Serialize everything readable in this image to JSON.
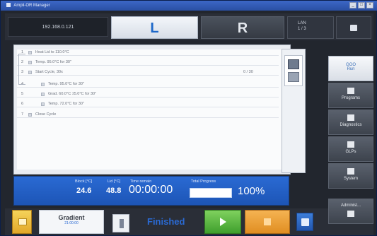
{
  "window": {
    "title": "Ampli-OR Manager"
  },
  "header": {
    "ip": "192.168.0.121",
    "tab_left": "L",
    "tab_right": "R",
    "lan_line1": "LAN",
    "lan_line2": "1 / 3"
  },
  "protocol": {
    "steps": [
      {
        "num": "1",
        "text": "Heat Lid to 110.0°C",
        "extra": ""
      },
      {
        "num": "2",
        "text": "Temp. 95.0°C for 30\"",
        "extra": ""
      },
      {
        "num": "3",
        "text": "Start Cycle, 30x",
        "extra": "0 / 30"
      },
      {
        "num": "4",
        "text": "Temp. 95.0°C for 30\"",
        "extra": ""
      },
      {
        "num": "5",
        "text": "Grad. 60.0°C ±5.0°C  for 30\"",
        "extra": ""
      },
      {
        "num": "6",
        "text": "Temp. 72.0°C for 30\"",
        "extra": ""
      },
      {
        "num": "7",
        "text": "Close Cycle",
        "extra": ""
      }
    ]
  },
  "status": {
    "block_label": "Block [°C]",
    "block_value": "24.6",
    "lid_label": "Lid [°C]",
    "lid_value": "48.8",
    "time_label": "Time remain",
    "time_value": "00:00:00",
    "progress_label": "Total Progress",
    "progress_percent": "100%",
    "progress_fraction": 1.0
  },
  "bottom": {
    "gradient_title": "Gradient",
    "gradient_sub": "21:00:00",
    "state": "Finished"
  },
  "nav": {
    "items": [
      {
        "label_line1": "GOO",
        "label_line2": "Run",
        "icon": "run-icon"
      },
      {
        "label_line1": "",
        "label_line2": "Programs",
        "icon": "programs-icon"
      },
      {
        "label_line1": "",
        "label_line2": "Diagnostics",
        "icon": "diagnostics-icon"
      },
      {
        "label_line1": "",
        "label_line2": "GLPs",
        "icon": "glps-icon"
      },
      {
        "label_line1": "",
        "label_line2": "System",
        "icon": "system-icon"
      },
      {
        "label_line1": "",
        "label_line2": "Administ...",
        "icon": "user-icon"
      }
    ]
  },
  "colors": {
    "accent_blue": "#2a6ad3",
    "play_green": "#3f9f2d",
    "stop_orange": "#e08e22"
  }
}
